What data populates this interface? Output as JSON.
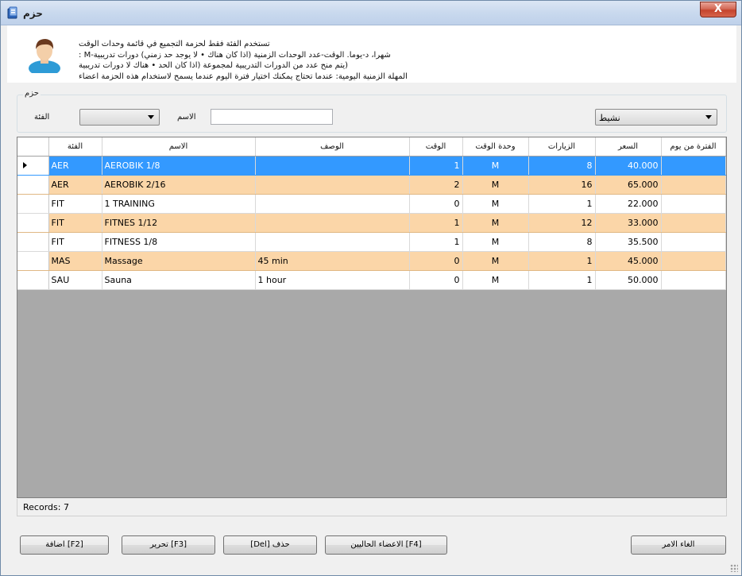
{
  "window": {
    "title": "حزم",
    "close_symbol": "X"
  },
  "info": {
    "lines": [
      "تستخدم الفئة فقط لحزمة التجميع في قائمة وحدات الوقت",
      "شهرا، د-يوما. الوقت-عدد الوحدات الزمنية (اذا كان هناك • لا يوجد حد زمني) دورات تدريبية-M :",
      "(يتم منح عدد من الدورات التدريبية لمجموعة (اذا كان الحد • هناك لا دورات تدريبية",
      "المهلة الزمنية اليومية: عندما تحتاج يمكنك اختيار فترة اليوم عندما يسمح لاستخدام هذه الحزمة اعضاء"
    ]
  },
  "filters": {
    "group_title": "حزم",
    "category_label": "الفئة",
    "category_value": "",
    "name_label": "الاسم",
    "name_value": "",
    "status_value": "نشيط"
  },
  "grid": {
    "columns": [
      "الفئة",
      "الاسم",
      "الوصف",
      "الوقت",
      "وحدة الوقت",
      "الزيارات",
      "السعر",
      "الفترة من يوم"
    ],
    "rows": [
      {
        "category": "AER",
        "name": "AEROBIK 1/8",
        "description": "",
        "time": "1",
        "unit": "M",
        "visits": "8",
        "price": "40.000",
        "period": ""
      },
      {
        "category": "AER",
        "name": "AEROBIK 2/16",
        "description": "",
        "time": "2",
        "unit": "M",
        "visits": "16",
        "price": "65.000",
        "period": ""
      },
      {
        "category": "FIT",
        "name": "1 TRAINING",
        "description": "",
        "time": "0",
        "unit": "M",
        "visits": "1",
        "price": "22.000",
        "period": ""
      },
      {
        "category": "FIT",
        "name": "FITNES 1/12",
        "description": "",
        "time": "1",
        "unit": "M",
        "visits": "12",
        "price": "33.000",
        "period": ""
      },
      {
        "category": "FIT",
        "name": "FITNESS 1/8",
        "description": "",
        "time": "1",
        "unit": "M",
        "visits": "8",
        "price": "35.500",
        "period": ""
      },
      {
        "category": "MAS",
        "name": "Massage",
        "description": "45 min",
        "time": "0",
        "unit": "M",
        "visits": "1",
        "price": "45.000",
        "period": ""
      },
      {
        "category": "SAU",
        "name": "Sauna",
        "description": "1 hour",
        "time": "0",
        "unit": "M",
        "visits": "1",
        "price": "50.000",
        "period": ""
      }
    ],
    "records_label": "Records: 7"
  },
  "buttons": {
    "add": "[F2] اضافة",
    "edit": "[F3] تحرير",
    "delete": "حذف [Del]",
    "current_members": "[F4] الاعضاء الحاليين",
    "cancel": "الغاء الامر"
  },
  "colors": {
    "selected_row": "#3399ff",
    "odd_row": "#fbd6a8",
    "grid_background": "#a9a9a9",
    "close_button": "#c5442d"
  }
}
